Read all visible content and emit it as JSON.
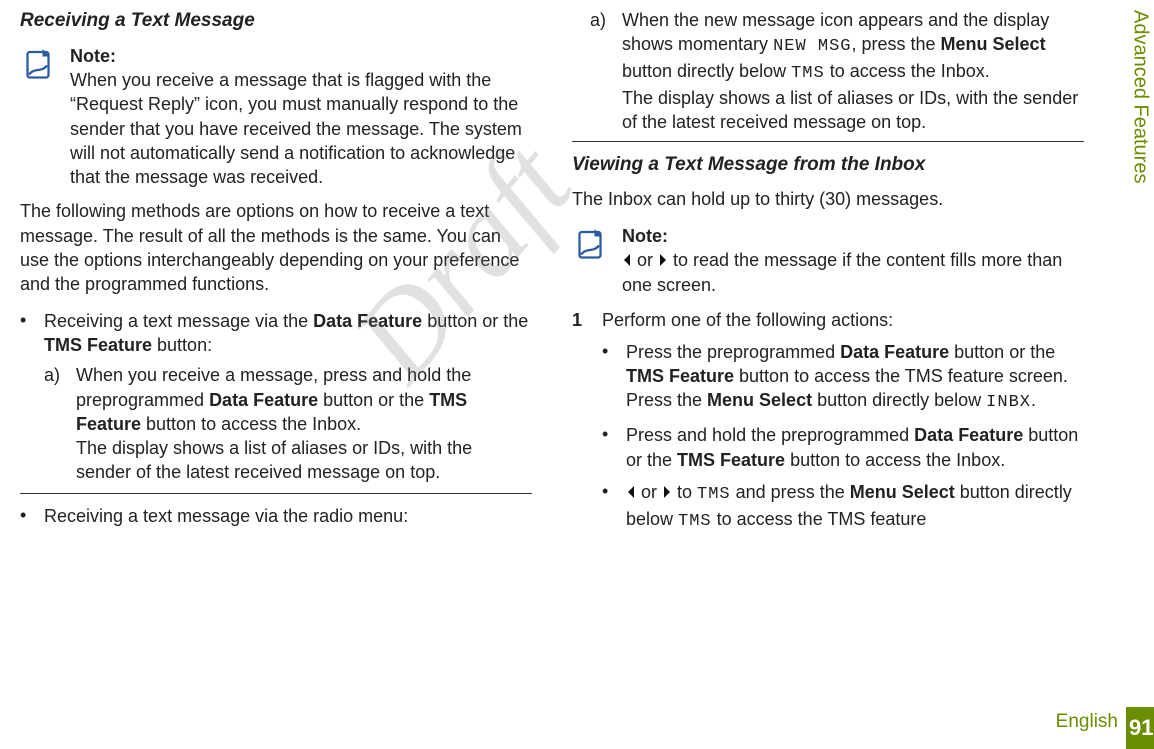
{
  "watermark": "Draft",
  "side": {
    "chapter": "Advanced Features",
    "pageNum": "91",
    "language": "English"
  },
  "left": {
    "h1": "Receiving a Text Message",
    "noteLabel": "Note:",
    "noteBody": "When you receive a message that is flagged with the “Request Reply” icon, you must manually respond to the sender that you have received the message. The system will not automatically send a notification to acknowledge that the message was received.",
    "para1": "The following methods are options on how to receive a text message. The result of all the methods is the same. You can use the options interchangeably depending on your preference and the programmed functions.",
    "b1_pre": "Receiving a text message via the ",
    "b1_bold1": "Data Feature",
    "b1_mid": " button or the ",
    "b1_bold2": "TMS Feature",
    "b1_post": " button:",
    "b1a_label": "a)",
    "b1a_l1_pre": "When you receive a message, press and hold the preprogrammed ",
    "b1a_l1_bold1": "Data Feature",
    "b1a_l1_mid": " button or the ",
    "b1a_l1_bold2": "TMS Feature",
    "b1a_l1_post": " button to access the Inbox.",
    "b1a_l2": "The display shows a list of aliases or IDs, with the sender of the latest received message on top.",
    "b2": "Receiving a text message via the radio menu:"
  },
  "right": {
    "a_label": "a)",
    "a_l1_pre": "When the new message icon appears and the display shows momentary ",
    "a_l1_mono1": "NEW MSG",
    "a_l1_mid1": ", press the ",
    "a_l1_bold": "Menu Select",
    "a_l1_mid2": " button directly below ",
    "a_l1_mono2": "TMS",
    "a_l1_post": " to access the Inbox.",
    "a_l2": "The display shows a list of aliases or IDs, with the sender of the latest received message on top.",
    "h2": "Viewing a Text Message from the Inbox",
    "para2": "The Inbox can hold up to thirty (30) messages.",
    "noteLabel": "Note:",
    "note_or": " or ",
    "note_post": " to read the message if the content fills more than one screen.",
    "step1_num": "1",
    "step1_text": "Perform one of the following actions:",
    "s1_pre": "Press the preprogrammed ",
    "s1_bold1": "Data Feature",
    "s1_mid1": " button or the ",
    "s1_bold2": "TMS Feature",
    "s1_mid2": " button to access the TMS feature screen. Press the ",
    "s1_bold3": "Menu Select",
    "s1_mid3": " button directly below ",
    "s1_mono": "INBX",
    "s1_post": ".",
    "s2_pre": "Press and hold the preprogrammed ",
    "s2_bold1": "Data Feature",
    "s2_mid": " button or the ",
    "s2_bold2": "TMS Feature",
    "s2_post": " button to access the Inbox.",
    "s3_or": " or ",
    "s3_mid1": " to ",
    "s3_mono1": "TMS",
    "s3_mid2": " and press the ",
    "s3_bold": "Menu Select",
    "s3_mid3": " button directly below ",
    "s3_mono2": "TMS",
    "s3_post": " to access the TMS feature"
  }
}
